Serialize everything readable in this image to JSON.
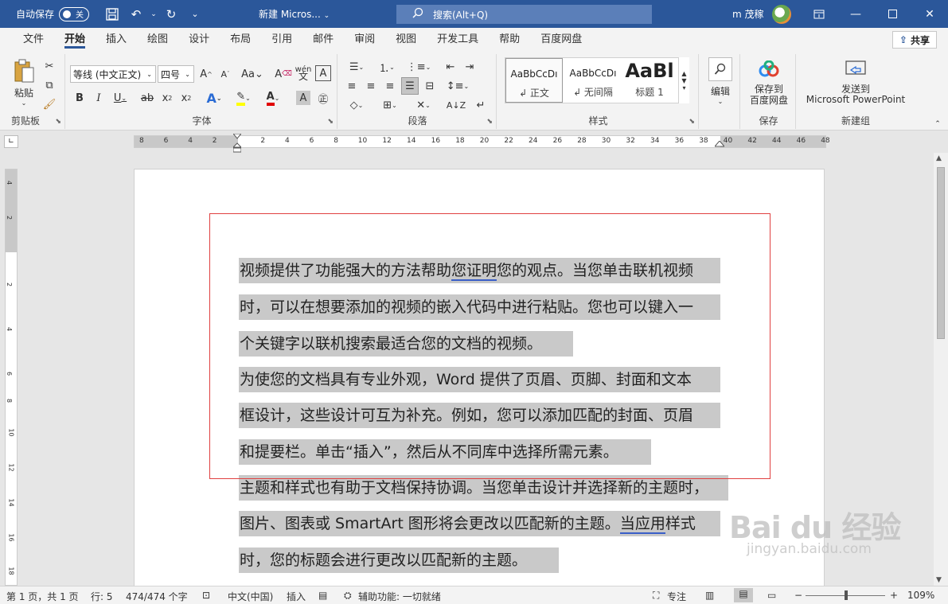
{
  "titlebar": {
    "autosave_label": "自动保存",
    "autosave_state": "关",
    "doc_title": "新建 Micros...",
    "doc_title_caret": "⌄",
    "search_placeholder": "搜索(Alt+Q)",
    "user_name": "m 茂稼",
    "accent_color": "#2b579a"
  },
  "tabs": [
    "文件",
    "开始",
    "插入",
    "绘图",
    "设计",
    "布局",
    "引用",
    "邮件",
    "审阅",
    "视图",
    "开发工具",
    "帮助",
    "百度网盘"
  ],
  "active_tab": "开始",
  "share_label": "共享",
  "ribbon": {
    "clipboard": {
      "paste": "粘贴",
      "label": "剪贴板"
    },
    "font": {
      "font_name": "等线 (中文正文)",
      "font_size": "四号",
      "label": "字体"
    },
    "paragraph": {
      "label": "段落"
    },
    "styles": {
      "label": "样式",
      "items": [
        {
          "sample": "AaBbCcDı",
          "name": "↲ 正文"
        },
        {
          "sample": "AaBbCcDı",
          "name": "↲ 无间隔"
        },
        {
          "sample": "AaBl",
          "name": "标题 1"
        }
      ]
    },
    "editing": {
      "label": "编辑"
    },
    "save": {
      "button": "保存到\n百度网盘",
      "button_line1": "保存到",
      "button_line2": "百度网盘",
      "label": "保存"
    },
    "newgroup": {
      "button_line1": "发送到",
      "button_line2": "Microsoft PowerPoint",
      "label": "新建组"
    }
  },
  "ruler_ticks": [
    "8",
    "6",
    "4",
    "2",
    "2",
    "4",
    "6",
    "8",
    "10",
    "12",
    "14",
    "16",
    "18",
    "20",
    "22",
    "24",
    "26",
    "28",
    "30",
    "32",
    "34",
    "36",
    "38",
    "40",
    "42",
    "44",
    "46",
    "48"
  ],
  "vruler_ticks": [
    "4",
    "2",
    "2",
    "4",
    "6",
    "8",
    "10",
    "12",
    "14",
    "16",
    "18"
  ],
  "document": {
    "lines": [
      {
        "pre": "视频提供了功能强大的方法帮助",
        "ul": "您证明",
        "post": "您的观点。当您单击联机视频"
      },
      {
        "pre": "时，可以在想要添加的视频的嵌入代码中进行粘贴。您也可以键入一",
        "ul": "",
        "post": ""
      },
      {
        "pre": "个关键字以联机搜索最适合您的文档的视频。",
        "ul": "",
        "post": ""
      },
      {
        "pre": "为使您的文档具有专业外观，Word 提供了页眉、页脚、封面和文本",
        "ul": "",
        "post": ""
      },
      {
        "pre": "框设计，这些设计可互为补充。例如，您可以添加匹配的封面、页眉",
        "ul": "",
        "post": ""
      },
      {
        "pre": "和提要栏。单击“插入”，然后从不同库中选择所需元素。",
        "ul": "",
        "post": ""
      },
      {
        "pre": "主题和样式也有助于文档保持协调。当您单击设计并选择新的主题时，",
        "ul": "",
        "post": ""
      },
      {
        "pre": "图片、图表或 SmartArt 图形将会更改以匹配新的主题。",
        "ul": "当应用",
        "post": "样式"
      },
      {
        "pre": "时，您的标题会进行更改以匹配新的主题。",
        "ul": "",
        "post": ""
      }
    ],
    "highlight_color": "#c9c9c9",
    "box_color": "#e04040"
  },
  "statusbar": {
    "page": "第 1 页，共 1 页",
    "line": "行: 5",
    "words": "474/474 个字",
    "language": "中文(中国)",
    "mode": "插入",
    "accessibility": "辅助功能: 一切就绪",
    "focus": "专注",
    "zoom": "109%"
  },
  "watermark": {
    "logo": "Bai du 经验",
    "url": "jingyan.baidu.com"
  }
}
